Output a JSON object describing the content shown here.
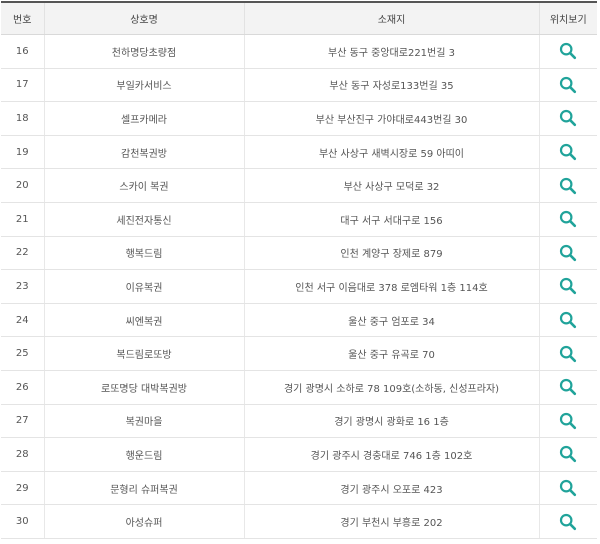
{
  "table": {
    "headers": {
      "number": "번호",
      "name": "상호명",
      "address": "소재지",
      "view_location": "위치보기"
    },
    "rows": [
      {
        "number": "16",
        "name": "천하명당초량점",
        "address": "부산 동구 중앙대로221번길 3"
      },
      {
        "number": "17",
        "name": "부일카서비스",
        "address": "부산 동구 자성로133번길 35"
      },
      {
        "number": "18",
        "name": "셀프카메라",
        "address": "부산 부산진구 가야대로443번길 30"
      },
      {
        "number": "19",
        "name": "감천복권방",
        "address": "부산 사상구 새벽시장로 59 아띠이"
      },
      {
        "number": "20",
        "name": "스카이 복권",
        "address": "부산 사상구 모덕로 32"
      },
      {
        "number": "21",
        "name": "세진전자통신",
        "address": "대구 서구 서대구로 156"
      },
      {
        "number": "22",
        "name": "행복드림",
        "address": "인천 계양구 장제로 879"
      },
      {
        "number": "23",
        "name": "이유복권",
        "address": "인천 서구 이음대로 378 로엠타워 1층 114호"
      },
      {
        "number": "24",
        "name": "씨엔복권",
        "address": "울산 중구 엄포로 34"
      },
      {
        "number": "25",
        "name": "복드림로또방",
        "address": "울산 중구 유곡로 70"
      },
      {
        "number": "26",
        "name": "로또명당 대박복권방",
        "address": "경기 광명시 소하로 78 109호(소하동, 신성프라자)"
      },
      {
        "number": "27",
        "name": "복권마을",
        "address": "경기 광명시 광화로 16 1층"
      },
      {
        "number": "28",
        "name": "행운드림",
        "address": "경기 광주시 경충대로 746 1층 102호"
      },
      {
        "number": "29",
        "name": "문형리 슈퍼복권",
        "address": "경기 광주시 오포로 423"
      },
      {
        "number": "30",
        "name": "아성슈퍼",
        "address": "경기 부천시 부흥로 202"
      }
    ]
  },
  "icons": {
    "view_location": "search-icon"
  },
  "colors": {
    "header_bg": "#f3f3f3",
    "header_top_border": "#555555",
    "row_divider": "#e4e4e4",
    "icon_teal": "#20a39a"
  }
}
